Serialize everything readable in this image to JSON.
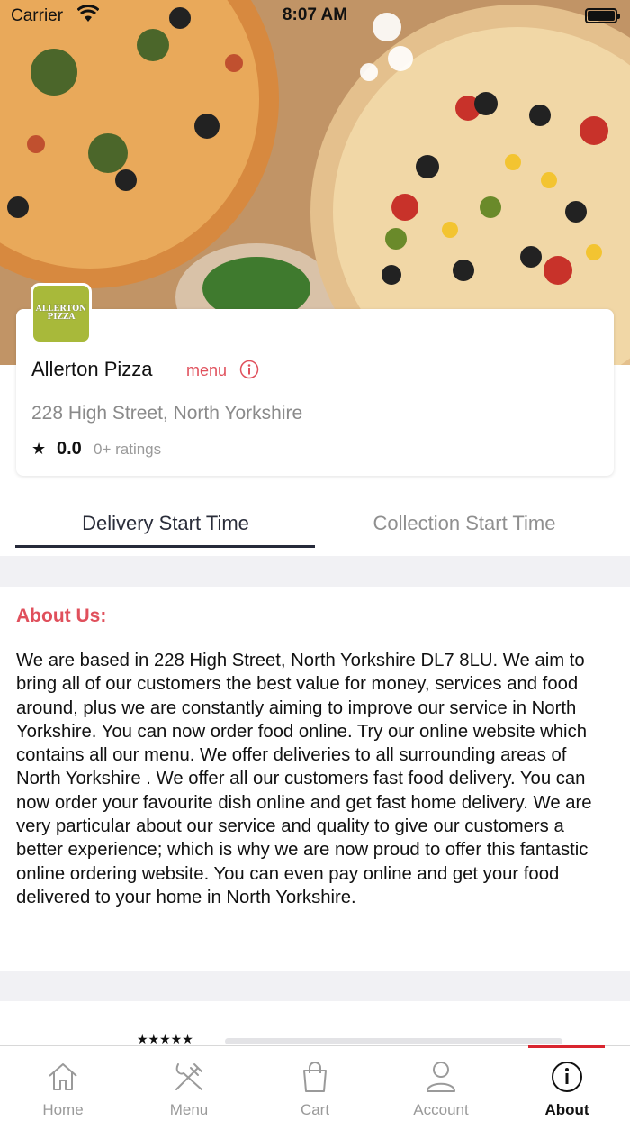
{
  "status_bar": {
    "carrier": "Carrier",
    "time": "8:07 AM"
  },
  "restaurant": {
    "logo_text": "ALLERTON PIZZA",
    "name": "Allerton Pizza",
    "menu_link": "menu",
    "address": "228 High Street, North Yorkshire",
    "rating": "0.0",
    "rating_count": "0+ ratings"
  },
  "tabs": [
    {
      "label": "Delivery Start Time",
      "active": true
    },
    {
      "label": "Collection Start Time",
      "active": false
    }
  ],
  "about": {
    "title": "About Us:",
    "text": "We are based in 228 High Street, North Yorkshire DL7 8LU. We aim to bring all of our customers the best value for money, services and food around, plus we are constantly aiming to improve our service in North Yorkshire. You can now order food online. Try our online website which contains all our menu. We offer deliveries to all surrounding areas of North Yorkshire . We offer all our customers fast food delivery. You can now order your favourite dish online and get fast home delivery. We are very particular about our service and quality to give our customers a better experience; which is why we are now proud to offer this fantastic online ordering website. You can even pay online and get your food delivered to your home in North Yorkshire."
  },
  "reviews": {
    "stars_label": "★★★★★"
  },
  "bottom_nav": [
    {
      "label": "Home",
      "icon": "home-icon"
    },
    {
      "label": "Menu",
      "icon": "cutlery-icon"
    },
    {
      "label": "Cart",
      "icon": "shopping-bag-icon"
    },
    {
      "label": "Account",
      "icon": "user-icon"
    },
    {
      "label": "About",
      "icon": "info-icon",
      "active": true
    }
  ],
  "colors": {
    "accent_red": "#e0505c",
    "active_tab_underline": "#262a3a",
    "nav_active_bar": "#d9252f",
    "logo_green": "#a8b93a"
  }
}
